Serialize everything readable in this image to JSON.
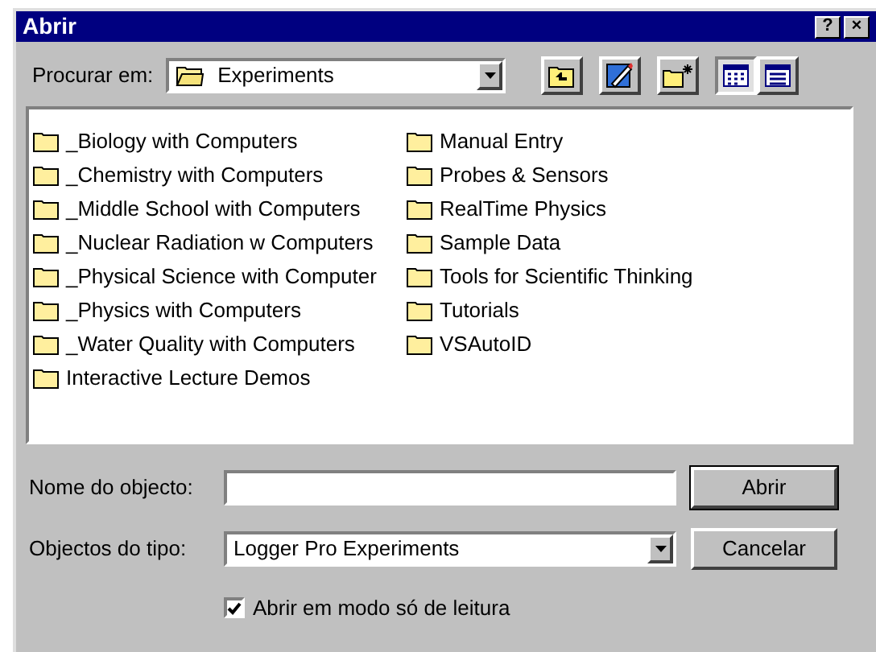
{
  "window": {
    "title": "Abrir",
    "title_buttons": [
      "?",
      "×"
    ]
  },
  "look_in": {
    "label": "Procurar em:",
    "value": "Experiments"
  },
  "toolbar": [
    {
      "kind": "up"
    },
    {
      "kind": "favorites"
    },
    {
      "kind": "new-folder"
    },
    {
      "kind": "list",
      "selected": true
    },
    {
      "kind": "details",
      "selected": false
    }
  ],
  "files": [
    {
      "name": "_Biology with Computers"
    },
    {
      "name": "_Chemistry with Computers"
    },
    {
      "name": "_Middle School with Computers"
    },
    {
      "name": "_Nuclear Radiation w Computers"
    },
    {
      "name": "_Physical Science with Computer"
    },
    {
      "name": "_Physics with Computers"
    },
    {
      "name": "_Water Quality with Computers"
    },
    {
      "name": "Interactive Lecture Demos"
    },
    {
      "name": "Manual Entry"
    },
    {
      "name": "Probes & Sensors"
    },
    {
      "name": "RealTime Physics"
    },
    {
      "name": "Sample Data"
    },
    {
      "name": "Tools for Scientific Thinking"
    },
    {
      "name": "Tutorials"
    },
    {
      "name": "VSAutoID"
    }
  ],
  "file_name": {
    "label": "Nome do objecto:"
  },
  "file_type": {
    "label": "Objectos do tipo:",
    "value": "Logger Pro Experiments"
  },
  "buttons": [
    {
      "label": "Abrir",
      "default": true
    },
    {
      "label": "Cancelar",
      "default": false
    }
  ],
  "read_only": {
    "label": "Abrir em modo só de leitura",
    "checked": true
  }
}
